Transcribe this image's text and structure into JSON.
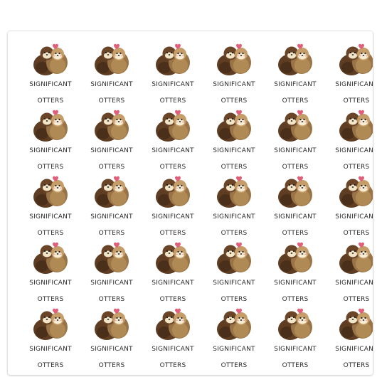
{
  "sticker": {
    "line1": "SIGNIFICANT",
    "line2": "OTTERS",
    "icon": "otter-couple-heart-icon"
  },
  "sheet": {
    "rows": 5,
    "columns": 6
  },
  "colors": {
    "sheet_background": "#ffffff",
    "dark_otter": "#5e3d22",
    "light_otter": "#b08a55",
    "face": "#f3e6c8",
    "heart": "#e0607a",
    "text": "#2a2a2a"
  }
}
